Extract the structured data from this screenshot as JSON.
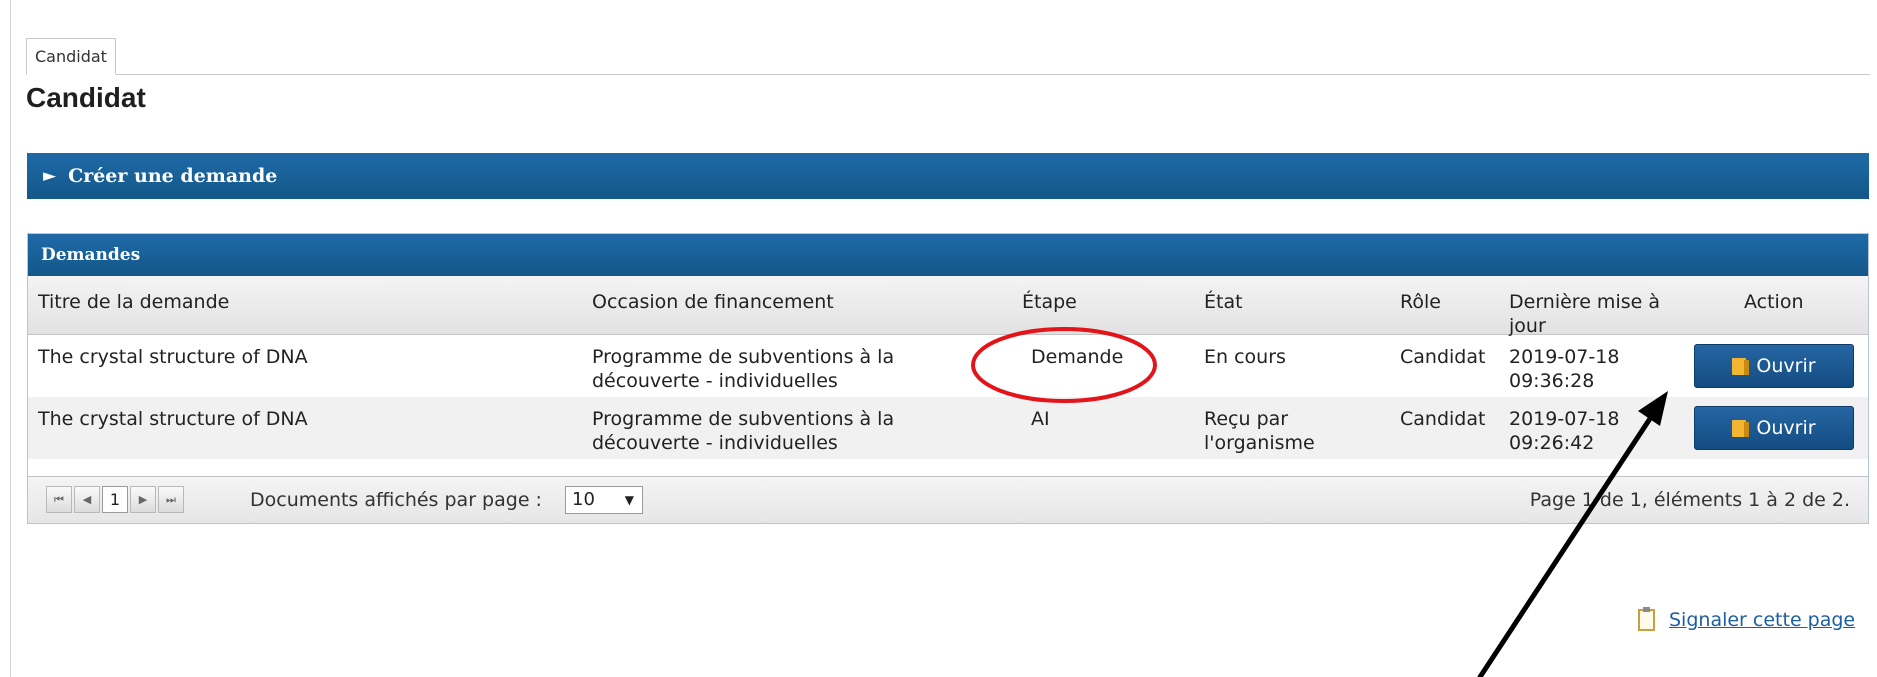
{
  "tab": {
    "label": "Candidat"
  },
  "page": {
    "title": "Candidat"
  },
  "create_section": {
    "arrow": "►",
    "label": "Créer une demande"
  },
  "requests": {
    "title": "Demandes",
    "columns": [
      "Titre de la demande",
      "Occasion de financement",
      "Étape",
      "État",
      "Rôle",
      "Dernière mise à jour",
      "Action"
    ],
    "rows": [
      {
        "title": "The crystal structure of DNA",
        "funding_line1": "Programme de subventions à la",
        "funding_line2": "découverte - individuelles",
        "stage": "Demande",
        "state_line1": "En cours",
        "state_line2": "",
        "role": "Candidat",
        "date": "2019-07-18",
        "time": "09:36:28",
        "action": "Ouvrir"
      },
      {
        "title": "The crystal structure of DNA",
        "funding_line1": "Programme de subventions à la",
        "funding_line2": "découverte - individuelles",
        "stage": "AI",
        "state_line1": "Reçu par",
        "state_line2": "l'organisme",
        "role": "Candidat",
        "date": "2019-07-18",
        "time": "09:26:42",
        "action": "Ouvrir"
      }
    ]
  },
  "pager": {
    "first": "⏮",
    "prev": "◀",
    "current": "1",
    "next": "▶",
    "last": "⏭",
    "per_page_label": "Documents affichés par page :",
    "per_page_value": "10",
    "info": "Page 1 de 1, éléments 1 à 2 de 2."
  },
  "footer": {
    "report_link": "Signaler cette page"
  },
  "colors": {
    "accent": "#17609a",
    "annotation_circle": "#e3151b",
    "annotation_arrow": "#000000"
  }
}
